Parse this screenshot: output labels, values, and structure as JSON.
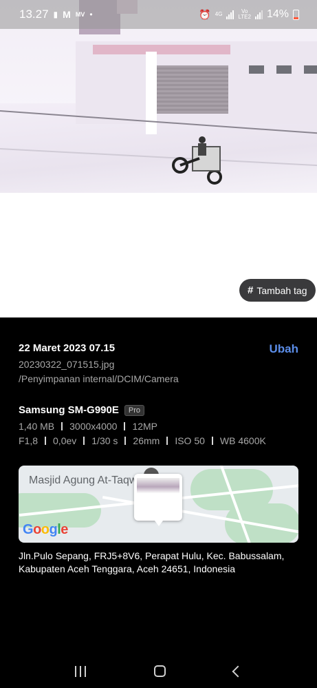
{
  "status_bar": {
    "time": "13.27",
    "network_4g": "4G",
    "volte_line1": "Vo",
    "volte_line2": "LTE2",
    "battery_percent": "14%",
    "icons": [
      "notification-icon",
      "gmail-icon",
      "mv-icon",
      "dot-icon",
      "alarm-icon",
      "signal-icon",
      "battery-icon"
    ]
  },
  "photo": {
    "tag_button_label": "Tambah tag"
  },
  "details": {
    "date_time": "22 Maret 2023 07.15",
    "edit_label": "Ubah",
    "filename": "20230322_071515.jpg",
    "path": "/Penyimpanan internal/DCIM/Camera",
    "device": "Samsung SM-G990E",
    "mode_badge": "Pro",
    "specs_row1": [
      "1,40 MB",
      "3000x4000",
      "12MP"
    ],
    "specs_row2": [
      "F1,8",
      "0,0ev",
      "1/30 s",
      "26mm",
      "ISO 50",
      "WB 4600K"
    ]
  },
  "map": {
    "place_label": "Masjid Agung At-Taqw",
    "brand": "Google",
    "brand_colors": [
      "#4285F4",
      "#EA4335",
      "#FBBC05",
      "#4285F4",
      "#34A853",
      "#EA4335"
    ]
  },
  "address": "Jln.Pulo Sepang, FRJ5+8V6, Perapat Hulu, Kec. Babussalam, Kabupaten Aceh Tenggara, Aceh 24651, Indonesia",
  "accent_color": "#5b8de8"
}
